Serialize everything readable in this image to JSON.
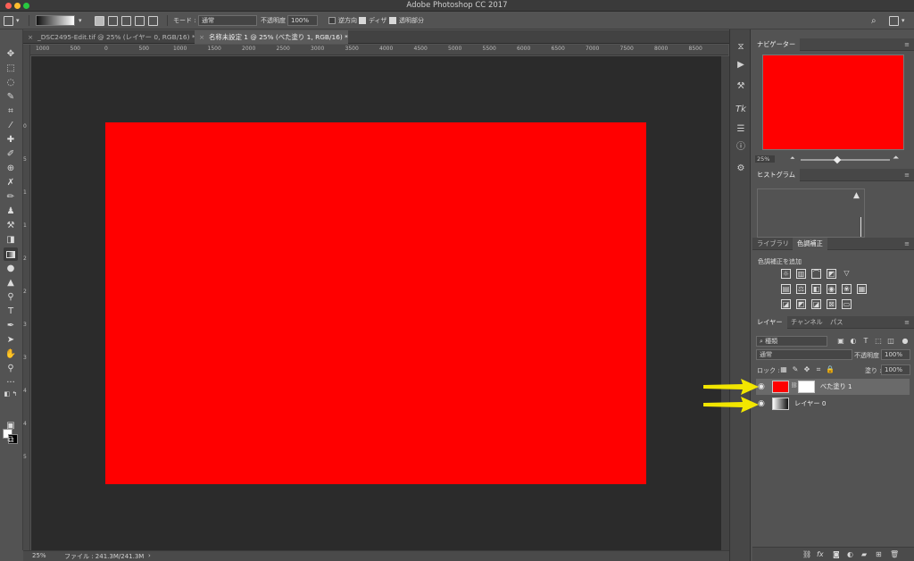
{
  "window": {
    "title": "Adobe Photoshop CC 2017"
  },
  "options_bar": {
    "mode_label": "モード :",
    "mode_value": "通常",
    "opacity_label": "不透明度 :",
    "opacity_value": "100%",
    "reverse_label": "逆方向",
    "dither_label": "ディザ",
    "transparency_label": "透明部分"
  },
  "tabs": [
    {
      "label": "_DSC2495-Edit.tif @ 25% (レイヤー 0, RGB/16) *",
      "active": false
    },
    {
      "label": "名称未設定 1 @ 25% (べた塗り 1, RGB/16) *",
      "active": true
    }
  ],
  "ruler": {
    "h_ticks": [
      "1000",
      "500",
      "0",
      "500",
      "1000",
      "1500",
      "2000",
      "2500",
      "3000",
      "3500",
      "4000",
      "4500",
      "5000",
      "5500",
      "6000",
      "6500",
      "7000",
      "7500",
      "8000",
      "8500"
    ],
    "v_ticks": [
      "0",
      "5",
      "1",
      "1",
      "2",
      "2",
      "3",
      "3",
      "4",
      "4",
      "5"
    ]
  },
  "status": {
    "zoom": "25%",
    "file_info": "ファイル : 241.3M/241.3M"
  },
  "document": {
    "fill_color": "#ff0000"
  },
  "navigator": {
    "tab": "ナビゲーター",
    "zoom": "25%",
    "thumb_color": "#ff0000"
  },
  "histogram": {
    "tab": "ヒストグラム"
  },
  "adjustments": {
    "tabs": [
      "ライブラリ",
      "色調補正"
    ],
    "add_label": "色調補正を追加"
  },
  "layers": {
    "tabs": [
      "レイヤー",
      "チャンネル",
      "パス"
    ],
    "filter_kind": "種類",
    "blend_mode": "通常",
    "opacity_label": "不透明度 :",
    "opacity_value": "100%",
    "lock_label": "ロック :",
    "fill_label": "塗り :",
    "fill_value": "100%",
    "items": [
      {
        "name": "べた塗り 1",
        "selected": true
      },
      {
        "name": "レイヤー 0",
        "selected": false
      }
    ]
  },
  "colors": {
    "foreground": "#ffffff",
    "background": "#000000",
    "annotation_arrow": "#f2e600"
  }
}
